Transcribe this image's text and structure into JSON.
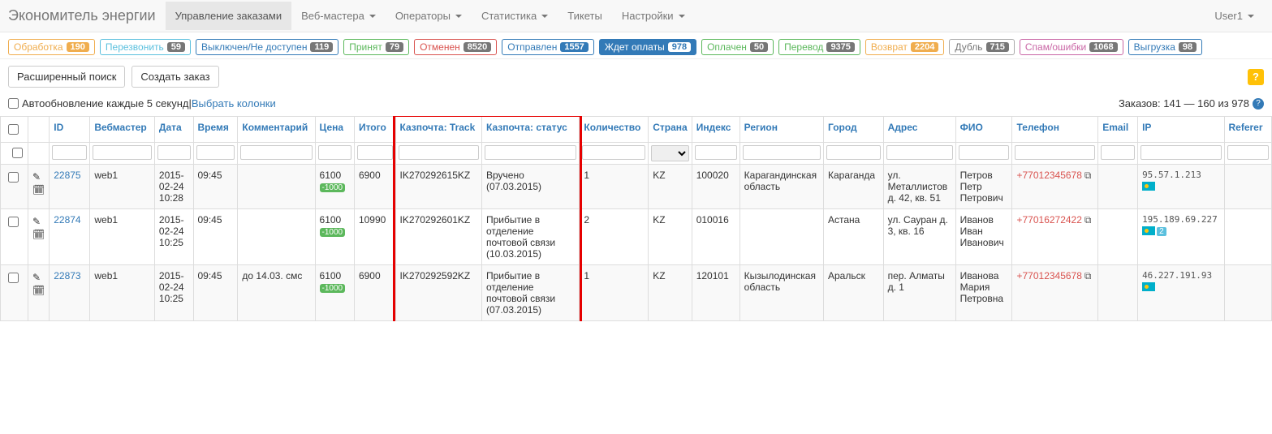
{
  "navbar": {
    "brand": "Экономитель энергии",
    "items": [
      {
        "label": "Управление заказами",
        "dropdown": false,
        "active": true
      },
      {
        "label": "Веб-мастера",
        "dropdown": true,
        "active": false
      },
      {
        "label": "Операторы",
        "dropdown": true,
        "active": false
      },
      {
        "label": "Статистика",
        "dropdown": true,
        "active": false
      },
      {
        "label": "Тикеты",
        "dropdown": false,
        "active": false
      },
      {
        "label": "Настройки",
        "dropdown": true,
        "active": false
      }
    ],
    "user": "User1"
  },
  "statuses": [
    {
      "label": "Обработка",
      "count": "190",
      "cls": "c-obrabotka"
    },
    {
      "label": "Перезвонить",
      "count": "59",
      "cls": "c-perezvon"
    },
    {
      "label": "Выключен/Не доступен",
      "count": "119",
      "cls": "c-vykl"
    },
    {
      "label": "Принят",
      "count": "79",
      "cls": "c-prinyat"
    },
    {
      "label": "Отменен",
      "count": "8520",
      "cls": "c-otmenen"
    },
    {
      "label": "Отправлен",
      "count": "1557",
      "cls": "c-otpravlen"
    },
    {
      "label": "Ждет оплаты",
      "count": "978",
      "cls": "c-zhdet"
    },
    {
      "label": "Оплачен",
      "count": "50",
      "cls": "c-oplachen"
    },
    {
      "label": "Перевод",
      "count": "9375",
      "cls": "c-perevod"
    },
    {
      "label": "Возврат",
      "count": "2204",
      "cls": "c-vozvrat"
    },
    {
      "label": "Дубль",
      "count": "715",
      "cls": "c-dubl"
    },
    {
      "label": "Спам/ошибки",
      "count": "1068",
      "cls": "c-spam"
    },
    {
      "label": "Выгрузка",
      "count": "98",
      "cls": "c-vygruzka"
    }
  ],
  "toolbar": {
    "advanced_search": "Расширенный поиск",
    "create_order": "Создать заказ"
  },
  "refresh": {
    "label": "Автообновление каждые 5 секунд",
    "sep": " | ",
    "columns": "Выбрать колонки",
    "count": "Заказов: 141 — 160 из 978"
  },
  "columns": [
    "",
    "",
    "ID",
    "Вебмастер",
    "Дата",
    "Время",
    "Комментарий",
    "Цена",
    "Итого",
    "Казпочта: Track",
    "Казпочта: статус",
    "Количество",
    "Страна",
    "Индекс",
    "Регион",
    "Город",
    "Адрес",
    "ФИО",
    "Телефон",
    "Email",
    "IP",
    "Referer"
  ],
  "rows": [
    {
      "id": "22875",
      "web": "web1",
      "date": "2015-02-24 10:28",
      "time": "09:45",
      "comment": "",
      "price": "6100",
      "discount": "-1000",
      "total": "6900",
      "track": "IK270292615KZ",
      "pstatus": "Вручено (07.03.2015)",
      "qty": "1",
      "country": "KZ",
      "index": "100020",
      "region": "Карагандинская область",
      "city": "Караганда",
      "addr": "ул. Металлистов д. 42, кв. 51",
      "fio": "Петров Петр Петрович",
      "phone": "+77012345678",
      "email": "",
      "ip": "95.57.1.213",
      "ipnote": ""
    },
    {
      "id": "22874",
      "web": "web1",
      "date": "2015-02-24 10:25",
      "time": "09:45",
      "comment": "",
      "price": "6100",
      "discount": "-1000",
      "total": "10990",
      "track": "IK270292601KZ",
      "pstatus": "Прибытие в отделение почтовой связи (10.03.2015)",
      "qty": "2",
      "country": "KZ",
      "index": "010016",
      "region": "",
      "city": "Астана",
      "addr": "ул. Сауран д. 3, кв. 16",
      "fio": "Иванов Иван Иванович",
      "phone": "+77016272422",
      "email": "",
      "ip": "195.189.69.227",
      "ipnote": "2"
    },
    {
      "id": "22873",
      "web": "web1",
      "date": "2015-02-24 10:25",
      "time": "09:45",
      "comment": "до 14.03. смс",
      "price": "6100",
      "discount": "-1000",
      "total": "6900",
      "track": "IK270292592KZ",
      "pstatus": "Прибытие в отделение почтовой связи (07.03.2015)",
      "qty": "1",
      "country": "KZ",
      "index": "120101",
      "region": "Кызылодинская область",
      "city": "Аральск",
      "addr": "пер. Алматы д. 1",
      "fio": "Иванова Мария Петровна",
      "phone": "+77012345678",
      "email": "",
      "ip": "46.227.191.93",
      "ipnote": ""
    }
  ]
}
